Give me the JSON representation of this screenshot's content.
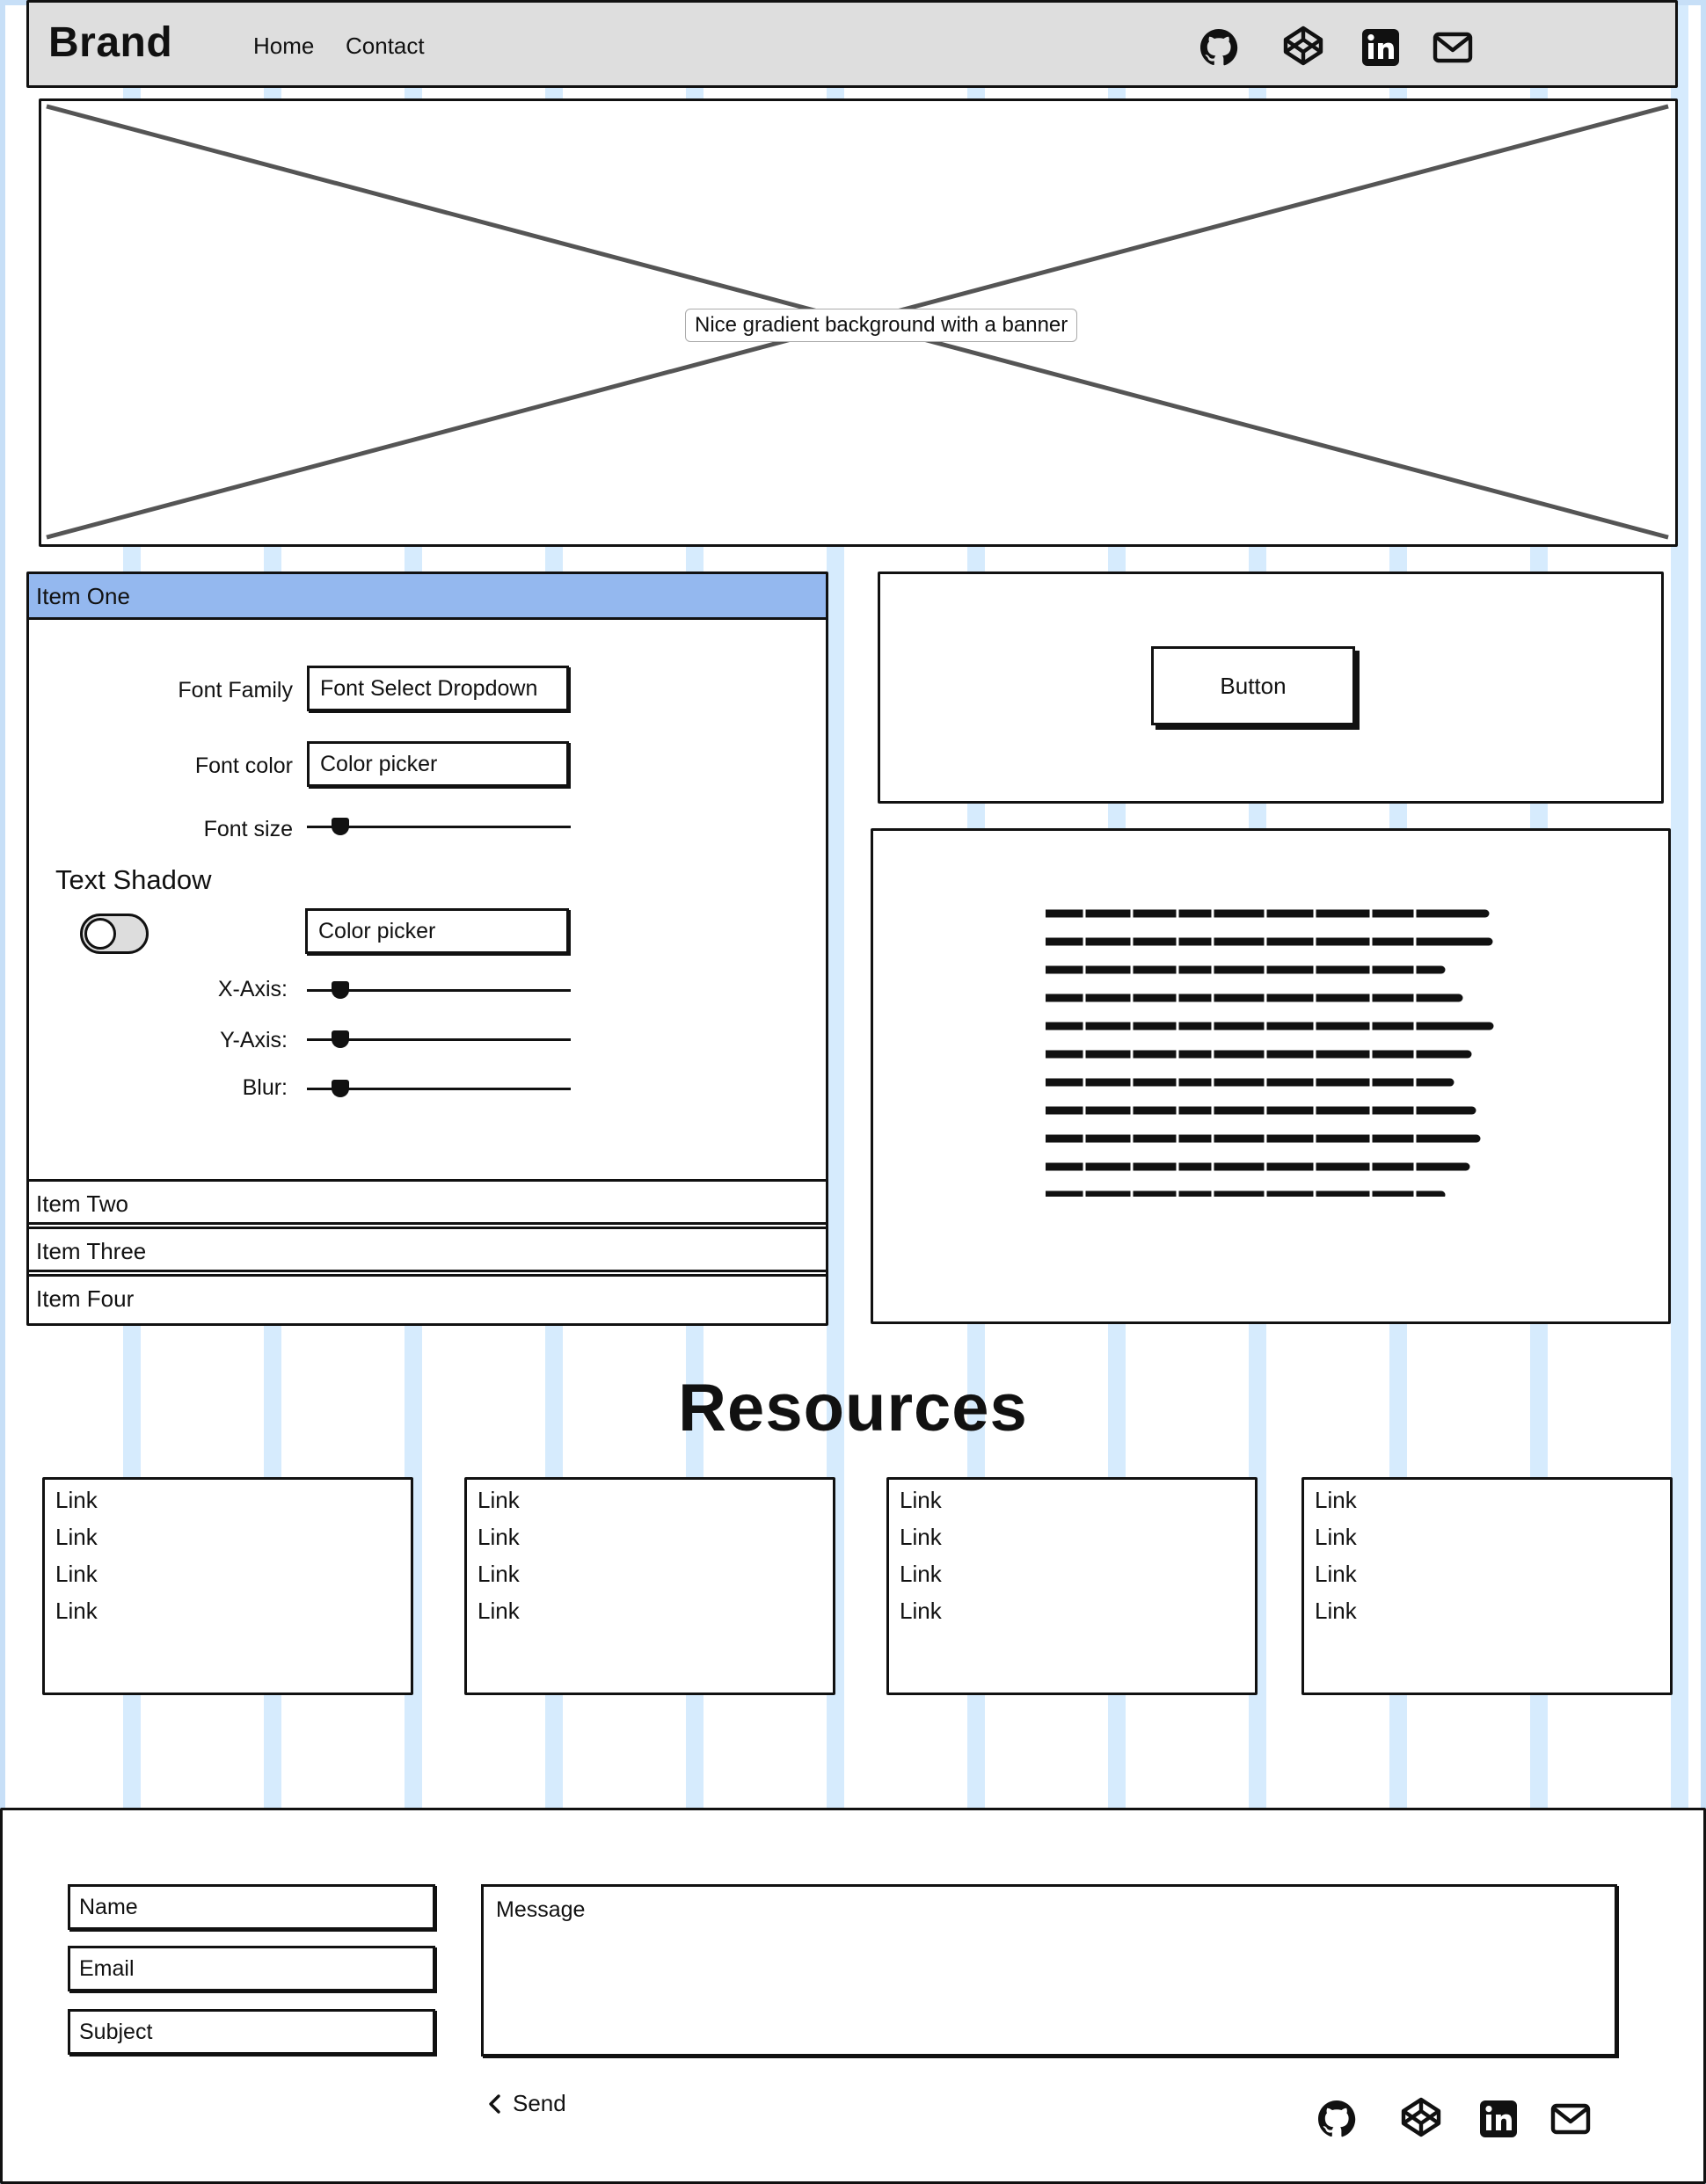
{
  "nav": {
    "brand": "Brand",
    "links": [
      {
        "label": "Home"
      },
      {
        "label": "Contact"
      }
    ],
    "icons": [
      "github-icon",
      "codepen-icon",
      "linkedin-icon",
      "mail-icon"
    ]
  },
  "banner": {
    "label": "Nice gradient background with a banner"
  },
  "accordion": {
    "items": [
      {
        "label": "Item One",
        "expanded": true
      },
      {
        "label": "Item Two",
        "expanded": false
      },
      {
        "label": "Item Three",
        "expanded": false
      },
      {
        "label": "Item Four",
        "expanded": false
      }
    ],
    "font_family_label": "Font Family",
    "font_family_value": "Font Select Dropdown",
    "font_color_label": "Font color",
    "font_color_value": "Color picker",
    "font_size_label": "Font size",
    "shadow_title": "Text Shadow",
    "shadow_color_value": "Color picker",
    "x_axis_label": "X-Axis:",
    "y_axis_label": "Y-Axis:",
    "blur_label": "Blur:",
    "slider_levels": {
      "font_size": 0.05,
      "x_axis": 0.05,
      "y_axis": 0.05,
      "blur": 0.05
    }
  },
  "panel": {
    "button_label": "Button"
  },
  "resources": {
    "title": "Resources",
    "columns": [
      [
        "Link",
        "Link",
        "Link",
        "Link"
      ],
      [
        "Link",
        "Link",
        "Link",
        "Link"
      ],
      [
        "Link",
        "Link",
        "Link",
        "Link"
      ],
      [
        "Link",
        "Link",
        "Link",
        "Link"
      ]
    ]
  },
  "footer": {
    "name_placeholder": "Name",
    "email_placeholder": "Email",
    "subject_placeholder": "Subject",
    "message_placeholder": "Message",
    "send_label": "Send",
    "icons": [
      "github-icon",
      "codepen-icon",
      "linkedin-icon",
      "mail-icon"
    ]
  },
  "colors": {
    "accent": "#94b8ef",
    "stripe": "#d6ebfd",
    "navbar_bg": "#dedede"
  }
}
